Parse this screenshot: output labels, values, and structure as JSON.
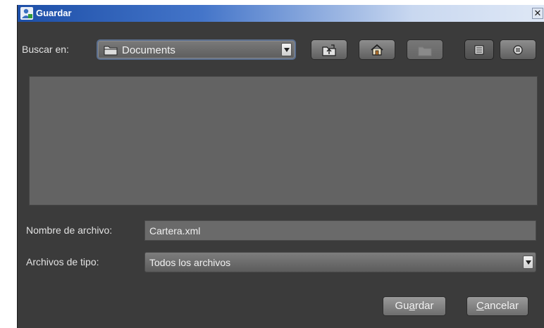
{
  "window": {
    "title": "Guardar",
    "close_glyph": "✕",
    "title_icon": "user-icon"
  },
  "lookin": {
    "label": "Buscar en:",
    "value": "Documents",
    "icon": "folder-icon"
  },
  "toolbar": {
    "buttons": [
      {
        "name": "up-folder",
        "icon": "up-folder-icon",
        "enabled": true
      },
      {
        "name": "home",
        "icon": "home-icon",
        "enabled": true
      },
      {
        "name": "new-folder",
        "icon": "new-folder-icon",
        "enabled": false
      },
      {
        "name": "list-view",
        "icon": "list-view-icon",
        "enabled": true,
        "selected": true
      },
      {
        "name": "details-view",
        "icon": "details-view-icon",
        "enabled": true
      }
    ]
  },
  "filename": {
    "label": "Nombre de archivo:",
    "value": "Cartera.xml"
  },
  "filetype": {
    "label": "Archivos de tipo:",
    "value": "Todos los archivos"
  },
  "buttons": {
    "save": {
      "pre": "Gu",
      "mnemonic": "a",
      "post": "rdar"
    },
    "cancel": {
      "pre": "",
      "mnemonic": "C",
      "post": "ancelar"
    }
  },
  "colors": {
    "background": "#3b3b3b",
    "titlebar_start": "#1d4fa8",
    "file_list": "#636363",
    "text": "#e2e2e2"
  }
}
